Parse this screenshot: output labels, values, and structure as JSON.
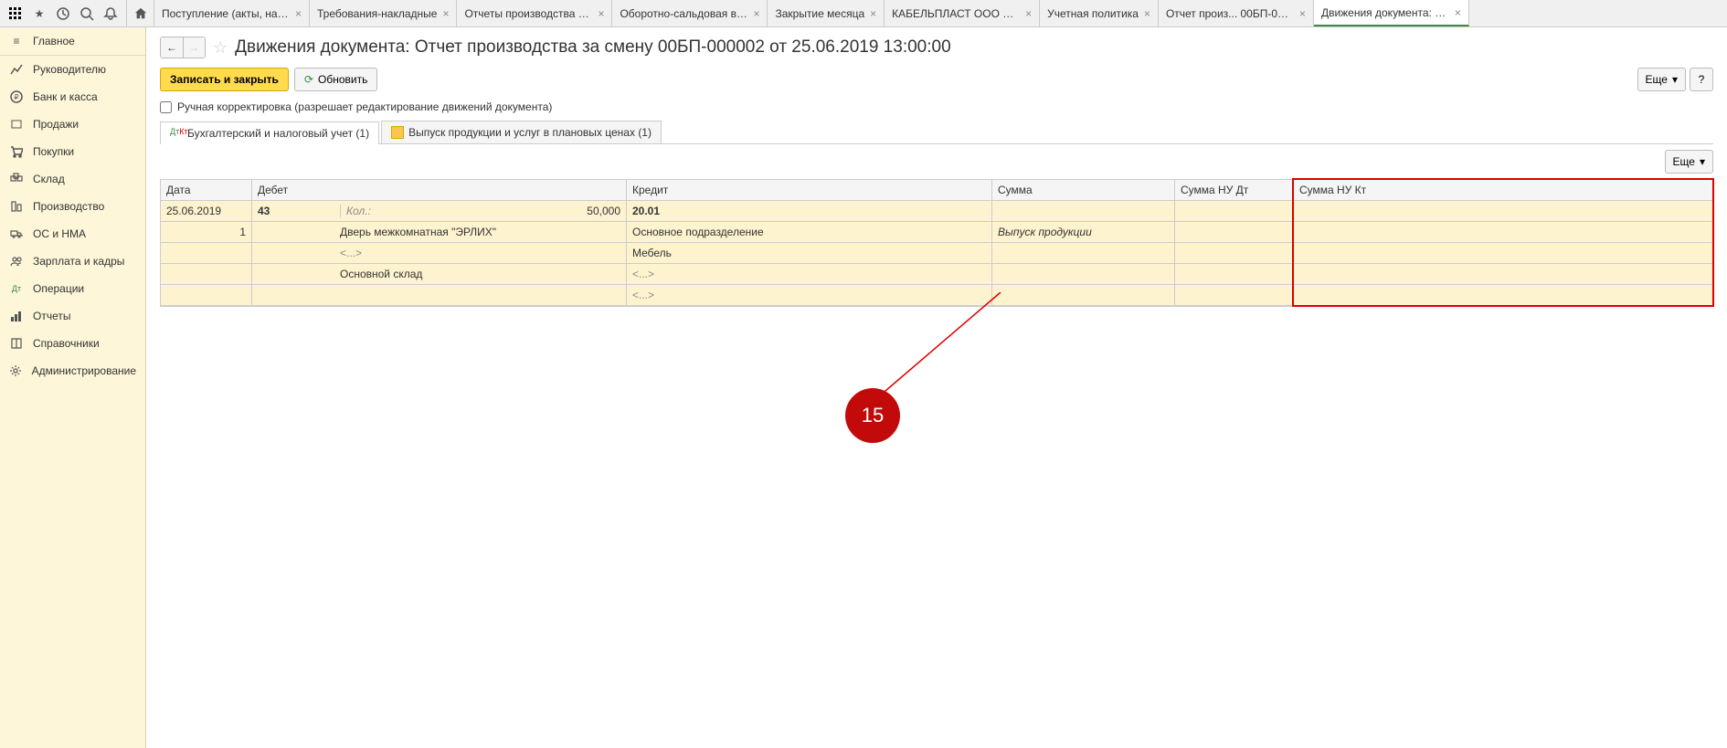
{
  "top_toolbar": {
    "icons": [
      "apps",
      "star",
      "history",
      "search",
      "bell"
    ]
  },
  "tabs": {
    "items": [
      {
        "label": "Поступление (акты, накла...",
        "active": false
      },
      {
        "label": "Требования-накладные",
        "active": false
      },
      {
        "label": "Отчеты производства за ...",
        "active": false
      },
      {
        "label": "Оборотно-сальдовая вед...",
        "active": false
      },
      {
        "label": "Закрытие месяца",
        "active": false
      },
      {
        "label": "КАБЕЛЬПЛАСТ ООО ТД ...",
        "active": false
      },
      {
        "label": "Учетная политика",
        "active": false
      },
      {
        "label": "Отчет произ... 00БП-000002",
        "active": false
      },
      {
        "label": "Движения документа: О...",
        "active": true
      }
    ]
  },
  "sidebar": {
    "head": "Главное",
    "items": [
      {
        "icon": "chart",
        "label": "Руководителю"
      },
      {
        "icon": "bank",
        "label": "Банк и касса"
      },
      {
        "icon": "sales",
        "label": "Продажи"
      },
      {
        "icon": "cart",
        "label": "Покупки"
      },
      {
        "icon": "box",
        "label": "Склад"
      },
      {
        "icon": "factory",
        "label": "Производство"
      },
      {
        "icon": "truck",
        "label": "ОС и НМА"
      },
      {
        "icon": "users",
        "label": "Зарплата и кадры"
      },
      {
        "icon": "dtkt",
        "label": "Операции"
      },
      {
        "icon": "reports",
        "label": "Отчеты"
      },
      {
        "icon": "book",
        "label": "Справочники"
      },
      {
        "icon": "gear",
        "label": "Администрирование"
      }
    ]
  },
  "page": {
    "title": "Движения документа: Отчет производства за смену 00БП-000002 от 25.06.2019 13:00:00",
    "btn_save": "Записать и закрыть",
    "btn_refresh": "Обновить",
    "btn_more": "Еще",
    "manual_edit": "Ручная корректировка (разрешает редактирование движений документа)"
  },
  "inner_tabs": {
    "t1": "Бухгалтерский и налоговый учет (1)",
    "t2": "Выпуск продукции и услуг в плановых ценах (1)"
  },
  "grid": {
    "headers": {
      "date": "Дата",
      "debit": "Дебет",
      "credit": "Кредит",
      "sum": "Сумма",
      "sum_nu_dt": "Сумма НУ Дт",
      "sum_nu_kt": "Сумма НУ Кт"
    },
    "row1": {
      "date": "25.06.2019",
      "debit_ac": "43",
      "qty_label": "Кол.:",
      "qty_val": "50,000",
      "credit_ac": "20.01"
    },
    "row2": {
      "num": "1",
      "debit_sub": "Дверь межкомнатная \"ЭРЛИХ\"",
      "credit_sub": "Основное подразделение",
      "sum": "Выпуск продукции"
    },
    "row3": {
      "debit_sub": "<...>",
      "credit_sub": "Мебель"
    },
    "row4": {
      "debit_sub": "Основной склад",
      "credit_sub": "<...>"
    },
    "row5": {
      "credit_sub": "<...>"
    }
  },
  "callout": {
    "number": "15"
  }
}
